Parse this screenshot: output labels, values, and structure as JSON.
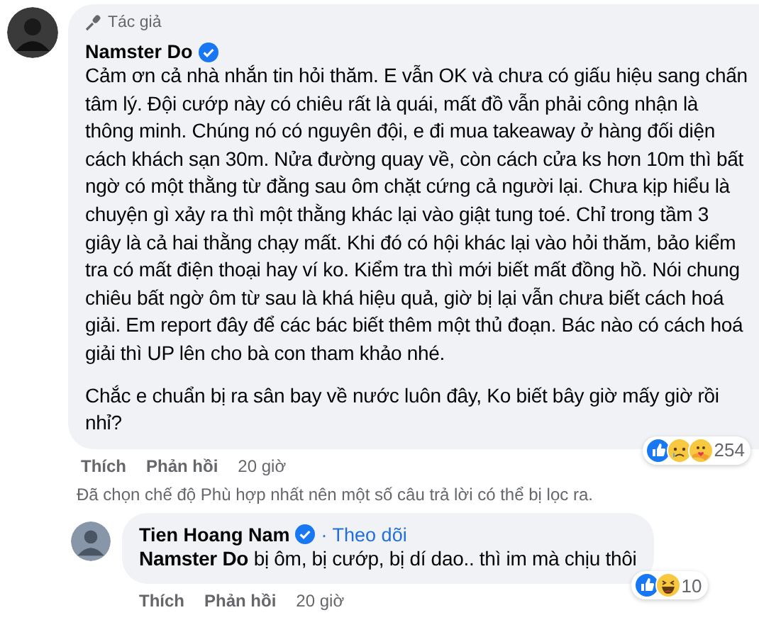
{
  "comments": [
    {
      "author_badge": "Tác giả",
      "author": "Namster Do",
      "verified": true,
      "paragraphs": [
        "Cảm ơn cả nhà nhắn tin hỏi thăm. E vẫn OK và chưa có giấu hiệu sang chấn tâm lý. Đội cướp này có chiêu rất là quái, mất đồ vẫn phải công nhận là thông minh. Chúng nó có nguyên đội, e đi mua takeaway ở hàng đối diện cách khách sạn 30m. Nửa đường quay về, còn cách cửa ks hơn 10m thì bất ngờ có một thằng từ đằng sau ôm chặt cứng cả người lại. Chưa kịp hiểu là chuyện gì xảy ra thì một thằng khác lại vào giật tung toé. Chỉ trong tầm 3 giây là cả hai thằng chạy mất. Khi đó có hội khác lại vào hỏi thăm, bảo kiểm tra có mất điện thoại hay ví ko. Kiểm tra thì mới biết mất đồng hồ. Nói chung chiêu bất ngờ ôm từ sau là khá hiệu quả, giờ bị lại vẫn chưa biết cách hoá giải. Em report đây để các bác biết thêm một thủ đoạn. Bác nào có cách hoá giải thì UP lên cho bà con tham khảo nhé.",
        "Chắc e chuẩn bị ra sân bay về nước luôn đây, Ko biết bây giờ mấy giờ rồi nhỉ?"
      ],
      "reactions": [
        {
          "kind": "like"
        },
        {
          "kind": "sad"
        },
        {
          "kind": "care"
        }
      ],
      "reaction_count": "254",
      "actions": [
        "Thích",
        "Phản hồi"
      ],
      "time": "20 giờ",
      "note": "Đã chọn chế độ Phù hợp nhất nên một số câu trả lời có thể bị lọc ra."
    },
    {
      "author": "Tien Hoang Nam",
      "verified": true,
      "follow": "· Theo dõi",
      "paragraphs": [
        "**Namster Do** bị ôm, bị cướp, bị dí dao.. thì im mà chịu thôi"
      ],
      "reactions": [
        {
          "kind": "like"
        },
        {
          "kind": "haha"
        }
      ],
      "reaction_count": "10",
      "actions": [
        "Thích",
        "Phản hồi"
      ],
      "time": "20 giờ"
    }
  ]
}
